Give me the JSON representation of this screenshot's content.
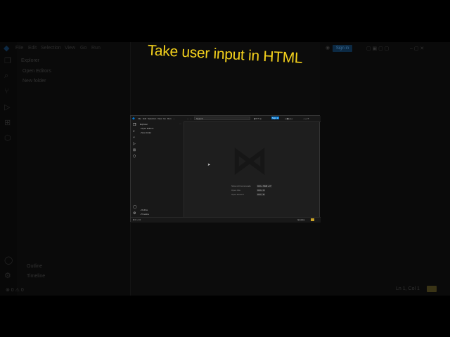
{
  "overlay_title": "Take user input in HTML",
  "bg": {
    "menu": [
      "File",
      "Edit",
      "Selection",
      "View",
      "Go",
      "Run",
      "…"
    ],
    "sidebar": {
      "header": "Explorer",
      "open_editors": "Open Editors",
      "folder": "New folder",
      "outline": "Outline",
      "timeline": "Timeline"
    },
    "signin": "Sign in",
    "status_left": "⊗ 0 ⚠ 0",
    "status_right": "Ln 1, Col 1"
  },
  "window": {
    "menu": [
      "File",
      "Edit",
      "Selection",
      "View",
      "Go",
      "Run",
      "…"
    ],
    "search": "Search",
    "signin": "Sign in",
    "sidebar": {
      "header": "Explorer",
      "open_editors": "Open Editors",
      "folder": "New folder",
      "outline": "Outline",
      "timeline": "Timeline"
    },
    "shortcuts": [
      {
        "label": "Show All Commands",
        "keys": "Ctrl + Shift + P"
      },
      {
        "label": "Open File",
        "keys": "Ctrl + O"
      },
      {
        "label": "Open Recent",
        "keys": "Ctrl + R"
      }
    ],
    "status_left": "⊗ 0 ⚠ 0",
    "status_right": "Quokka"
  }
}
